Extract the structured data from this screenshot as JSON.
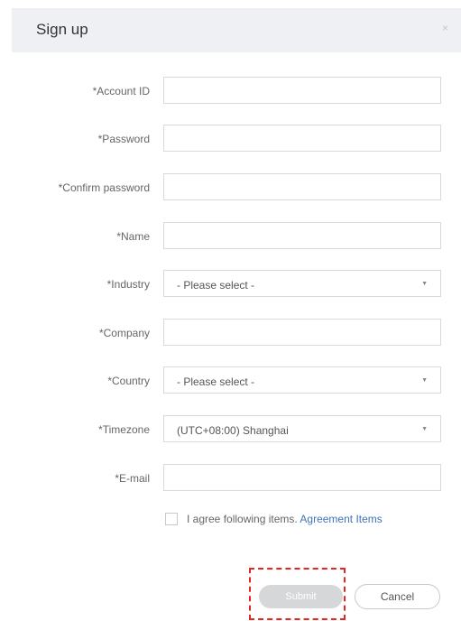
{
  "dialog": {
    "title": "Sign up",
    "close_icon": "×"
  },
  "form": {
    "fields": [
      {
        "label": "*Account ID",
        "type": "text",
        "value": ""
      },
      {
        "label": "*Password",
        "type": "text",
        "value": ""
      },
      {
        "label": "*Confirm password",
        "type": "text",
        "value": ""
      },
      {
        "label": "*Name",
        "type": "text",
        "value": ""
      },
      {
        "label": "*Industry",
        "type": "select",
        "value": "- Please select -"
      },
      {
        "label": "*Company",
        "type": "text",
        "value": ""
      },
      {
        "label": "*Country",
        "type": "select",
        "value": "- Please select -"
      },
      {
        "label": "*Timezone",
        "type": "select",
        "value": "(UTC+08:00) Shanghai"
      },
      {
        "label": "*E-mail",
        "type": "text",
        "value": ""
      }
    ],
    "agreement": {
      "text": "I agree following items.",
      "link": "Agreement Items",
      "checked": false
    }
  },
  "actions": {
    "submit_label": "Submit",
    "cancel_label": "Cancel"
  },
  "colors": {
    "header_bg": "#eef0f3",
    "link": "#3f74b8",
    "highlight": "#e52521",
    "submit_bg": "#d6d7d9"
  }
}
